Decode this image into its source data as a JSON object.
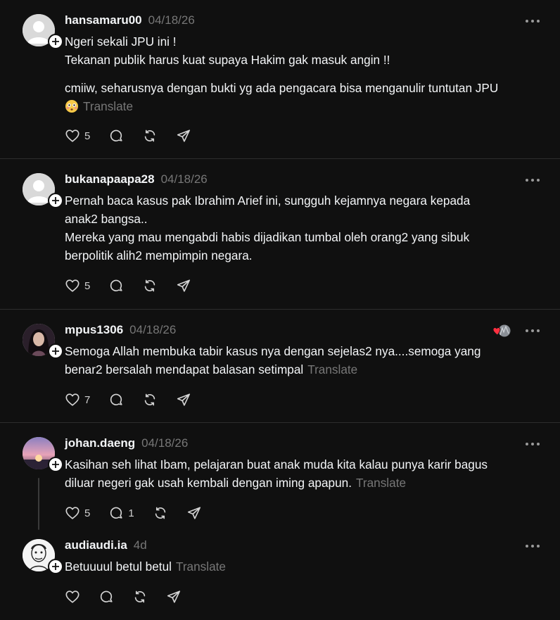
{
  "translate_label": "Translate",
  "posts": [
    {
      "username": "hansamaru00",
      "date": "04/18/26",
      "lines": [
        "Ngeri sekali JPU ini !",
        "Tekanan publik harus kuat supaya Hakim gak masuk angin !!"
      ],
      "lines2": [
        "cmiiw, seharusnya dengan bukti yg ada pengacara bisa menganulir tuntutan JPU"
      ],
      "likes": "5"
    },
    {
      "username": "bukanapaapa28",
      "date": "04/18/26",
      "lines": [
        "Pernah baca kasus pak Ibrahim Arief ini, sungguh kejamnya negara kepada",
        "anak2 bangsa..",
        "Mereka yang mau mengabdi habis dijadikan tumbal oleh orang2 yang sibuk",
        "berpolitik alih2 mempimpin negara."
      ],
      "likes": "5"
    },
    {
      "username": "mpus1306",
      "date": "04/18/26",
      "lines": [
        "Semoga Allah membuka tabir kasus nya dengan sejelas2 nya....semoga yang",
        "benar2 bersalah mendapat balasan setimpal"
      ],
      "likes": "7"
    },
    {
      "username": "johan.daeng",
      "date": "04/18/26",
      "lines": [
        "Kasihan seh lihat Ibam, pelajaran buat anak muda kita kalau punya karir bagus",
        "diluar negeri gak usah kembali dengan iming apapun."
      ],
      "likes": "5",
      "replies": "1"
    },
    {
      "username": "audiaudi.ia",
      "date": "4d",
      "lines": [
        "Betuuuul betul betul"
      ]
    }
  ],
  "icons": {
    "like": "heart-icon",
    "reply": "comment-icon",
    "repost": "repost-icon",
    "share": "share-icon",
    "more": "more-icon",
    "follow": "plus-icon"
  }
}
